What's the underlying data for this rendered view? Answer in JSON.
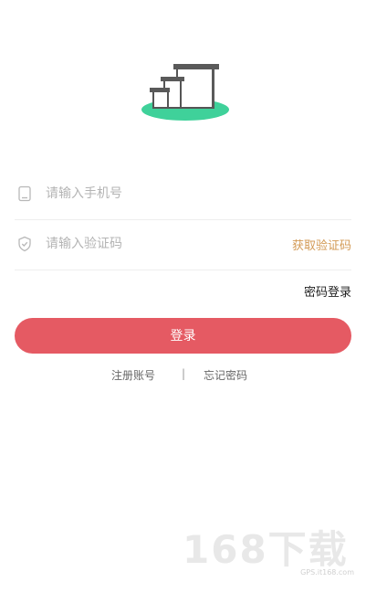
{
  "form": {
    "phone_placeholder": "请输入手机号",
    "code_placeholder": "请输入验证码",
    "get_code_label": "获取验证码"
  },
  "actions": {
    "password_login_label": "密码登录",
    "login_label": "登录",
    "register_label": "注册账号",
    "divider": "|",
    "forgot_label": "忘记密码"
  },
  "watermark": {
    "text": "168下载",
    "url": "GPS.it168.com"
  },
  "colors": {
    "primary": "#e55a63",
    "link_accent": "#d39a55",
    "logo_green": "#3fd19a",
    "logo_gray": "#5a5a5a"
  },
  "icons": {
    "phone": "phone-icon",
    "shield": "shield-icon",
    "logo": "house-logo"
  }
}
